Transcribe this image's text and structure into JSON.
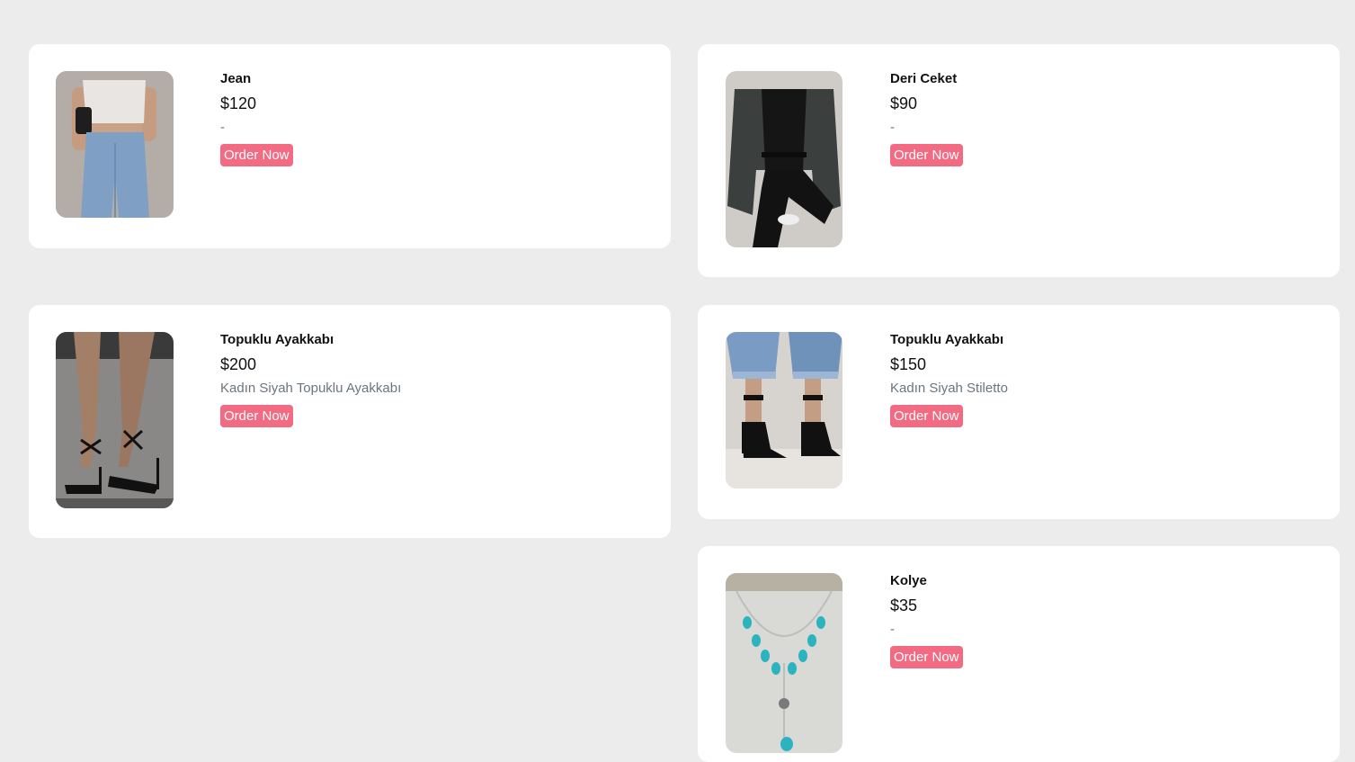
{
  "products": [
    {
      "name": "Jean",
      "price": "$120",
      "description": "-",
      "button": "Order Now",
      "image": "jeans-outfit-photo"
    },
    {
      "name": "Deri Ceket",
      "price": "$90",
      "description": "-",
      "button": "Order Now",
      "image": "leather-jacket-photo"
    },
    {
      "name": "Topuklu Ayakkabı",
      "price": "$200",
      "description": "Kadın Siyah Topuklu Ayakkabı",
      "button": "Order Now",
      "image": "strappy-heels-photo"
    },
    {
      "name": "Topuklu Ayakkabı",
      "price": "$150",
      "description": "Kadın Siyah Stiletto",
      "button": "Order Now",
      "image": "stiletto-photo"
    },
    {
      "name": "Kolye",
      "price": "$35",
      "description": "-",
      "button": "Order Now",
      "image": "turquoise-necklace-photo"
    }
  ],
  "colors": {
    "background": "#ececec",
    "card": "#ffffff",
    "button": "#f26b83",
    "description": "#6c757d"
  }
}
